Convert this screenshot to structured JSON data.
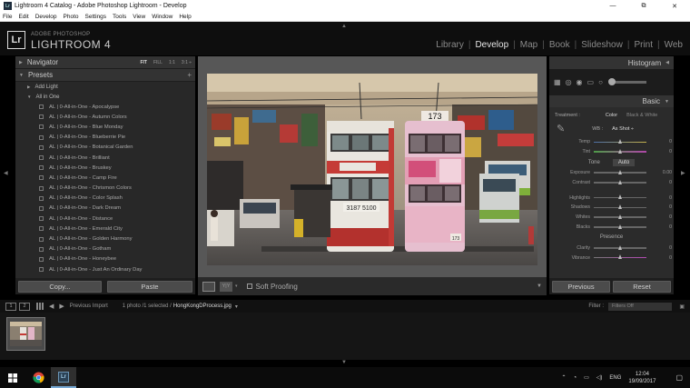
{
  "window": {
    "title": "Lightroom 4 Catalog - Adobe Photoshop Lightroom - Develop",
    "lr_badge": "Lr",
    "controls": [
      "—",
      "⧉",
      "✕"
    ]
  },
  "menu": [
    "File",
    "Edit",
    "Develop",
    "Photo",
    "Settings",
    "Tools",
    "View",
    "Window",
    "Help"
  ],
  "identity": {
    "logo": "Lr",
    "brand_small": "ADOBE PHOTOSHOP",
    "brand_big": "LIGHTROOM 4",
    "modules": [
      "Library",
      "Develop",
      "Map",
      "Book",
      "Slideshow",
      "Print",
      "Web"
    ],
    "active_module": "Develop"
  },
  "navigator": {
    "title": "Navigator",
    "zoom_options": [
      "FIT",
      "FILL",
      "1:1",
      "3:1 ÷"
    ],
    "active_zoom": "FIT"
  },
  "presets": {
    "title": "Presets",
    "add": "+",
    "folders": [
      "Add Light",
      "All in One"
    ],
    "items": [
      "AL | 0-All-in-One - Apocalypse",
      "AL | 0-All-in-One - Autumn Colors",
      "AL | 0-All-in-One - Blue Monday",
      "AL | 0-All-in-One - Blueberrie Pie",
      "AL | 0-All-in-One - Botanical Garden",
      "AL | 0-All-in-One - Brilliant",
      "AL | 0-All-in-One - Bruskey",
      "AL | 0-All-in-One - Camp Fire",
      "AL | 0-All-in-One - Chrismon Colors",
      "AL | 0-All-in-One - Color Splash",
      "AL | 0-All-in-One - Dark Dream",
      "AL | 0-All-in-One - Distance",
      "AL | 0-All-in-One - Emerald City",
      "AL | 0-All-in-One - Golden Harmony",
      "AL | 0-All-in-One - Gotham",
      "AL | 0-All-in-One - Honeybee",
      "AL | 0-All-in-One - Just An Ordinary Day"
    ]
  },
  "left_buttons": {
    "copy": "Copy...",
    "paste": "Paste"
  },
  "toolbar": {
    "yy": "Y|Y",
    "soft_proofing": "Soft Proofing"
  },
  "histogram": {
    "title": "Histogram"
  },
  "basic": {
    "title": "Basic",
    "treatment_label": "Treatment :",
    "treatment_color": "Color",
    "treatment_bw": "Black & White",
    "wb_label": "WB :",
    "wb_value": "As Shot ÷",
    "temp_tint": [
      {
        "label": "Temp",
        "value": "0"
      },
      {
        "label": "Tint",
        "value": "0"
      }
    ],
    "tone_label": "Tone",
    "auto_label": "Auto",
    "tone_sliders": [
      {
        "label": "Exposure",
        "value": "0.00"
      },
      {
        "label": "Contrast",
        "value": "0"
      }
    ],
    "tone_sliders2": [
      {
        "label": "Highlights",
        "value": "0"
      },
      {
        "label": "Shadows",
        "value": "0"
      },
      {
        "label": "Whites",
        "value": "0"
      },
      {
        "label": "Blacks",
        "value": "0"
      }
    ],
    "presence_label": "Presence",
    "presence_sliders": [
      {
        "label": "Clarity",
        "value": "0"
      },
      {
        "label": "Vibrance",
        "value": "0"
      }
    ]
  },
  "right_buttons": {
    "previous": "Previous",
    "reset": "Reset"
  },
  "filmstrip": {
    "page1": "1",
    "page2": "2",
    "previous_import": "Previous Import",
    "photo_count": "1 photo /1 selected /",
    "filename": "HongKongDProcess.jpg",
    "filename_arrow": "▾",
    "filter_label": "Filter :",
    "filter_value": "Filters Off"
  },
  "photo_text": {
    "tram1": "3187 5100",
    "tram2": "173",
    "tram2_fleet": "173"
  },
  "taskbar": {
    "tray_lang": "ENG",
    "time": "12:04",
    "date": "19/09/2017"
  },
  "colors": {
    "panel_bg": "#2b2b2b",
    "center_bg": "#575757",
    "accent_blue": "#76a8d4"
  }
}
